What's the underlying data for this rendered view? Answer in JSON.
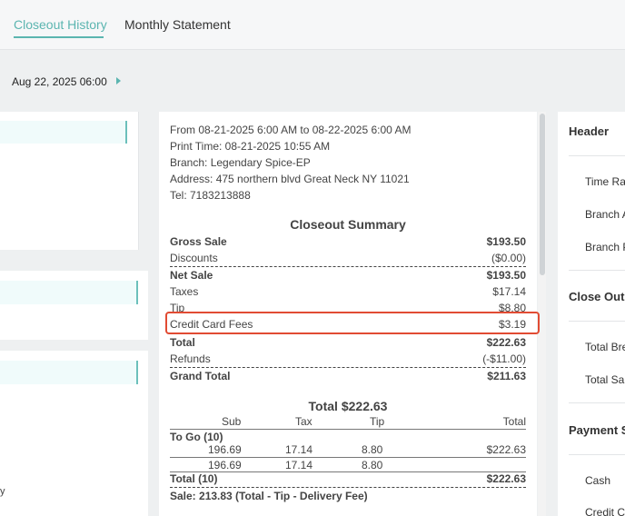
{
  "tabs": [
    {
      "label": "Closeout History"
    },
    {
      "label": "Monthly Statement"
    }
  ],
  "date_range": {
    "label": "Aug 22, 2025 06:00"
  },
  "left_edge_text": "y",
  "receipt": {
    "header_lines": [
      "From 08-21-2025 6:00 AM to 08-22-2025 6:00 AM",
      "Print Time: 08-21-2025 10:55 AM",
      "Branch: Legendary Spice-EP",
      "Address: 475 northern blvd Great Neck NY 11021",
      "Tel: 7183213888"
    ],
    "summary_title": "Closeout Summary",
    "summary_rows": [
      {
        "label": "Gross Sale",
        "value": "$193.50"
      },
      {
        "label": "Discounts",
        "value": "($0.00)"
      },
      {
        "label": "Net Sale",
        "value": "$193.50"
      },
      {
        "label": "Taxes",
        "value": "$17.14"
      },
      {
        "label": "Tip",
        "value": "$8.80"
      },
      {
        "label": "Credit Card Fees",
        "value": "$3.19"
      },
      {
        "label": "Total",
        "value": "$222.63"
      },
      {
        "label": "Refunds",
        "value": "(-$11.00)"
      },
      {
        "label": "Grand Total",
        "value": "$211.63"
      }
    ],
    "total_title": "Total $222.63",
    "table_headers": [
      "Sub",
      "Tax",
      "Tip",
      "Total"
    ],
    "group_label": "To Go (10)",
    "table_rows": [
      [
        "196.69",
        "17.14",
        "8.80",
        "$222.63"
      ],
      [
        "196.69",
        "17.14",
        "8.80",
        ""
      ]
    ],
    "table_total_label": "Total (10)",
    "table_total_value": "$222.63",
    "sale_line": "Sale: 213.83 (Total - Tip - Delivery Fee)"
  },
  "right_panel": {
    "sections": [
      "Header",
      "Close Out",
      "Payment S"
    ],
    "header_items": [
      "Time Ra",
      "Branch A",
      "Branch P"
    ],
    "closeout_items": [
      "Total Bre",
      "Total Sal"
    ],
    "payment_items": [
      "Cash",
      "Credit C"
    ]
  },
  "colors": {
    "accent": "#5bb5b0",
    "highlight": "#e14b33"
  }
}
